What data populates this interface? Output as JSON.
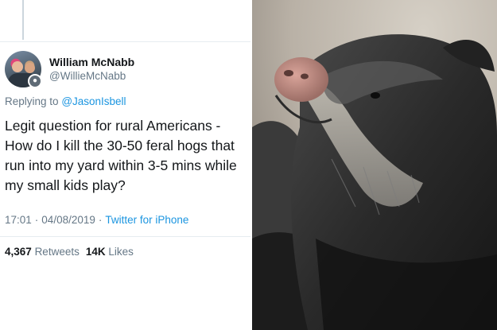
{
  "tweet": {
    "display_name": "William McNabb",
    "handle": "@WillieMcNabb",
    "reply_prefix": "Replying to",
    "reply_to": "@JasonIsbell",
    "text": "Legit question for rural Americans - How do I kill the 30-50 feral hogs that run into my yard within 3-5 mins while my small kids play?",
    "time": "17:01",
    "date": "04/08/2019",
    "separator": "·",
    "client": "Twitter for iPhone",
    "retweets_count": "4,367",
    "retweets_label": "Retweets",
    "likes_count": "14K",
    "likes_label": "Likes"
  },
  "icons": {
    "verify_badge": "account-badge-icon"
  },
  "colors": {
    "link": "#1b95e0",
    "secondary_text": "#657786",
    "primary_text": "#14171a",
    "divider": "#e6ecf0"
  }
}
